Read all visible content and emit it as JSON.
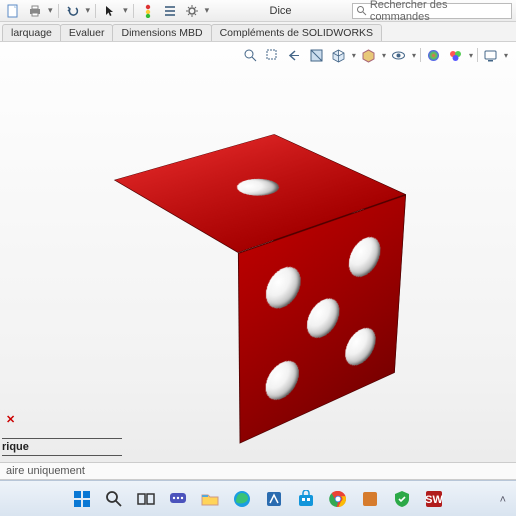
{
  "titlebar": {
    "title": "Dice",
    "search_placeholder": "Rechercher des commandes"
  },
  "tabs": {
    "t1": "larquage",
    "t2": "Evaluer",
    "t3": "Dimensions MBD",
    "t4": "Compléments de SOLIDWORKS"
  },
  "tree": {
    "hint": "rique"
  },
  "status": {
    "mode": "aire uniquement"
  },
  "icons": {
    "new": "new-file-icon",
    "save": "save-icon",
    "print": "print-icon",
    "undo": "undo-icon",
    "select": "select-arrow-icon",
    "traffic": "traffic-light-icon",
    "list": "list-icon",
    "gear": "gear-icon",
    "search": "search-icon",
    "zoomfit": "zoom-fit-icon",
    "zoomarea": "zoom-area-icon",
    "orbit": "orbit-icon",
    "section": "section-view-icon",
    "display": "display-style-icon",
    "hide": "hide-show-icon",
    "appearance": "appearance-icon",
    "scene": "scene-icon",
    "render": "render-icon",
    "screen": "screen-icon"
  }
}
